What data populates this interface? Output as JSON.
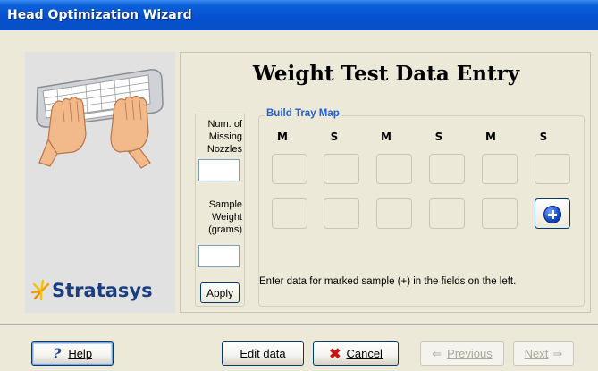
{
  "window": {
    "title": "Head Optimization Wizard"
  },
  "brand": {
    "name": "Stratasys"
  },
  "page_title": "Weight Test Data Entry",
  "inputs": {
    "missing_nozzles_label": [
      "Num. of",
      "Missing",
      "Nozzles"
    ],
    "missing_nozzles_value": "",
    "sample_weight_label": [
      "Sample",
      "Weight",
      "(grams)"
    ],
    "sample_weight_value": "",
    "apply_label": "Apply"
  },
  "tray": {
    "title": "Build Tray Map",
    "columns": [
      "M",
      "S",
      "M",
      "S",
      "M",
      "S"
    ],
    "rows": 2,
    "marked_cell": {
      "row": 2,
      "column": 6
    },
    "note": "Enter data for marked sample (+) in the fields on the left."
  },
  "buttons": {
    "help": "Help",
    "edit_data": "Edit data",
    "cancel": "Cancel",
    "previous": "Previous",
    "next": "Next"
  },
  "icons": {
    "help": "help-question-icon",
    "cancel": "red-x-icon",
    "previous": "left-arrow-icon",
    "next": "right-arrow-icon",
    "marked": "blue-plus-icon",
    "illustration": "keyboard-hands-icon",
    "logo": "stratasys-star-icon"
  },
  "colors": {
    "titlebar": "#0a5fd8",
    "tray_title": "#2160d8",
    "brand": "#1b3f7e",
    "cancel_icon": "#c4150e"
  }
}
